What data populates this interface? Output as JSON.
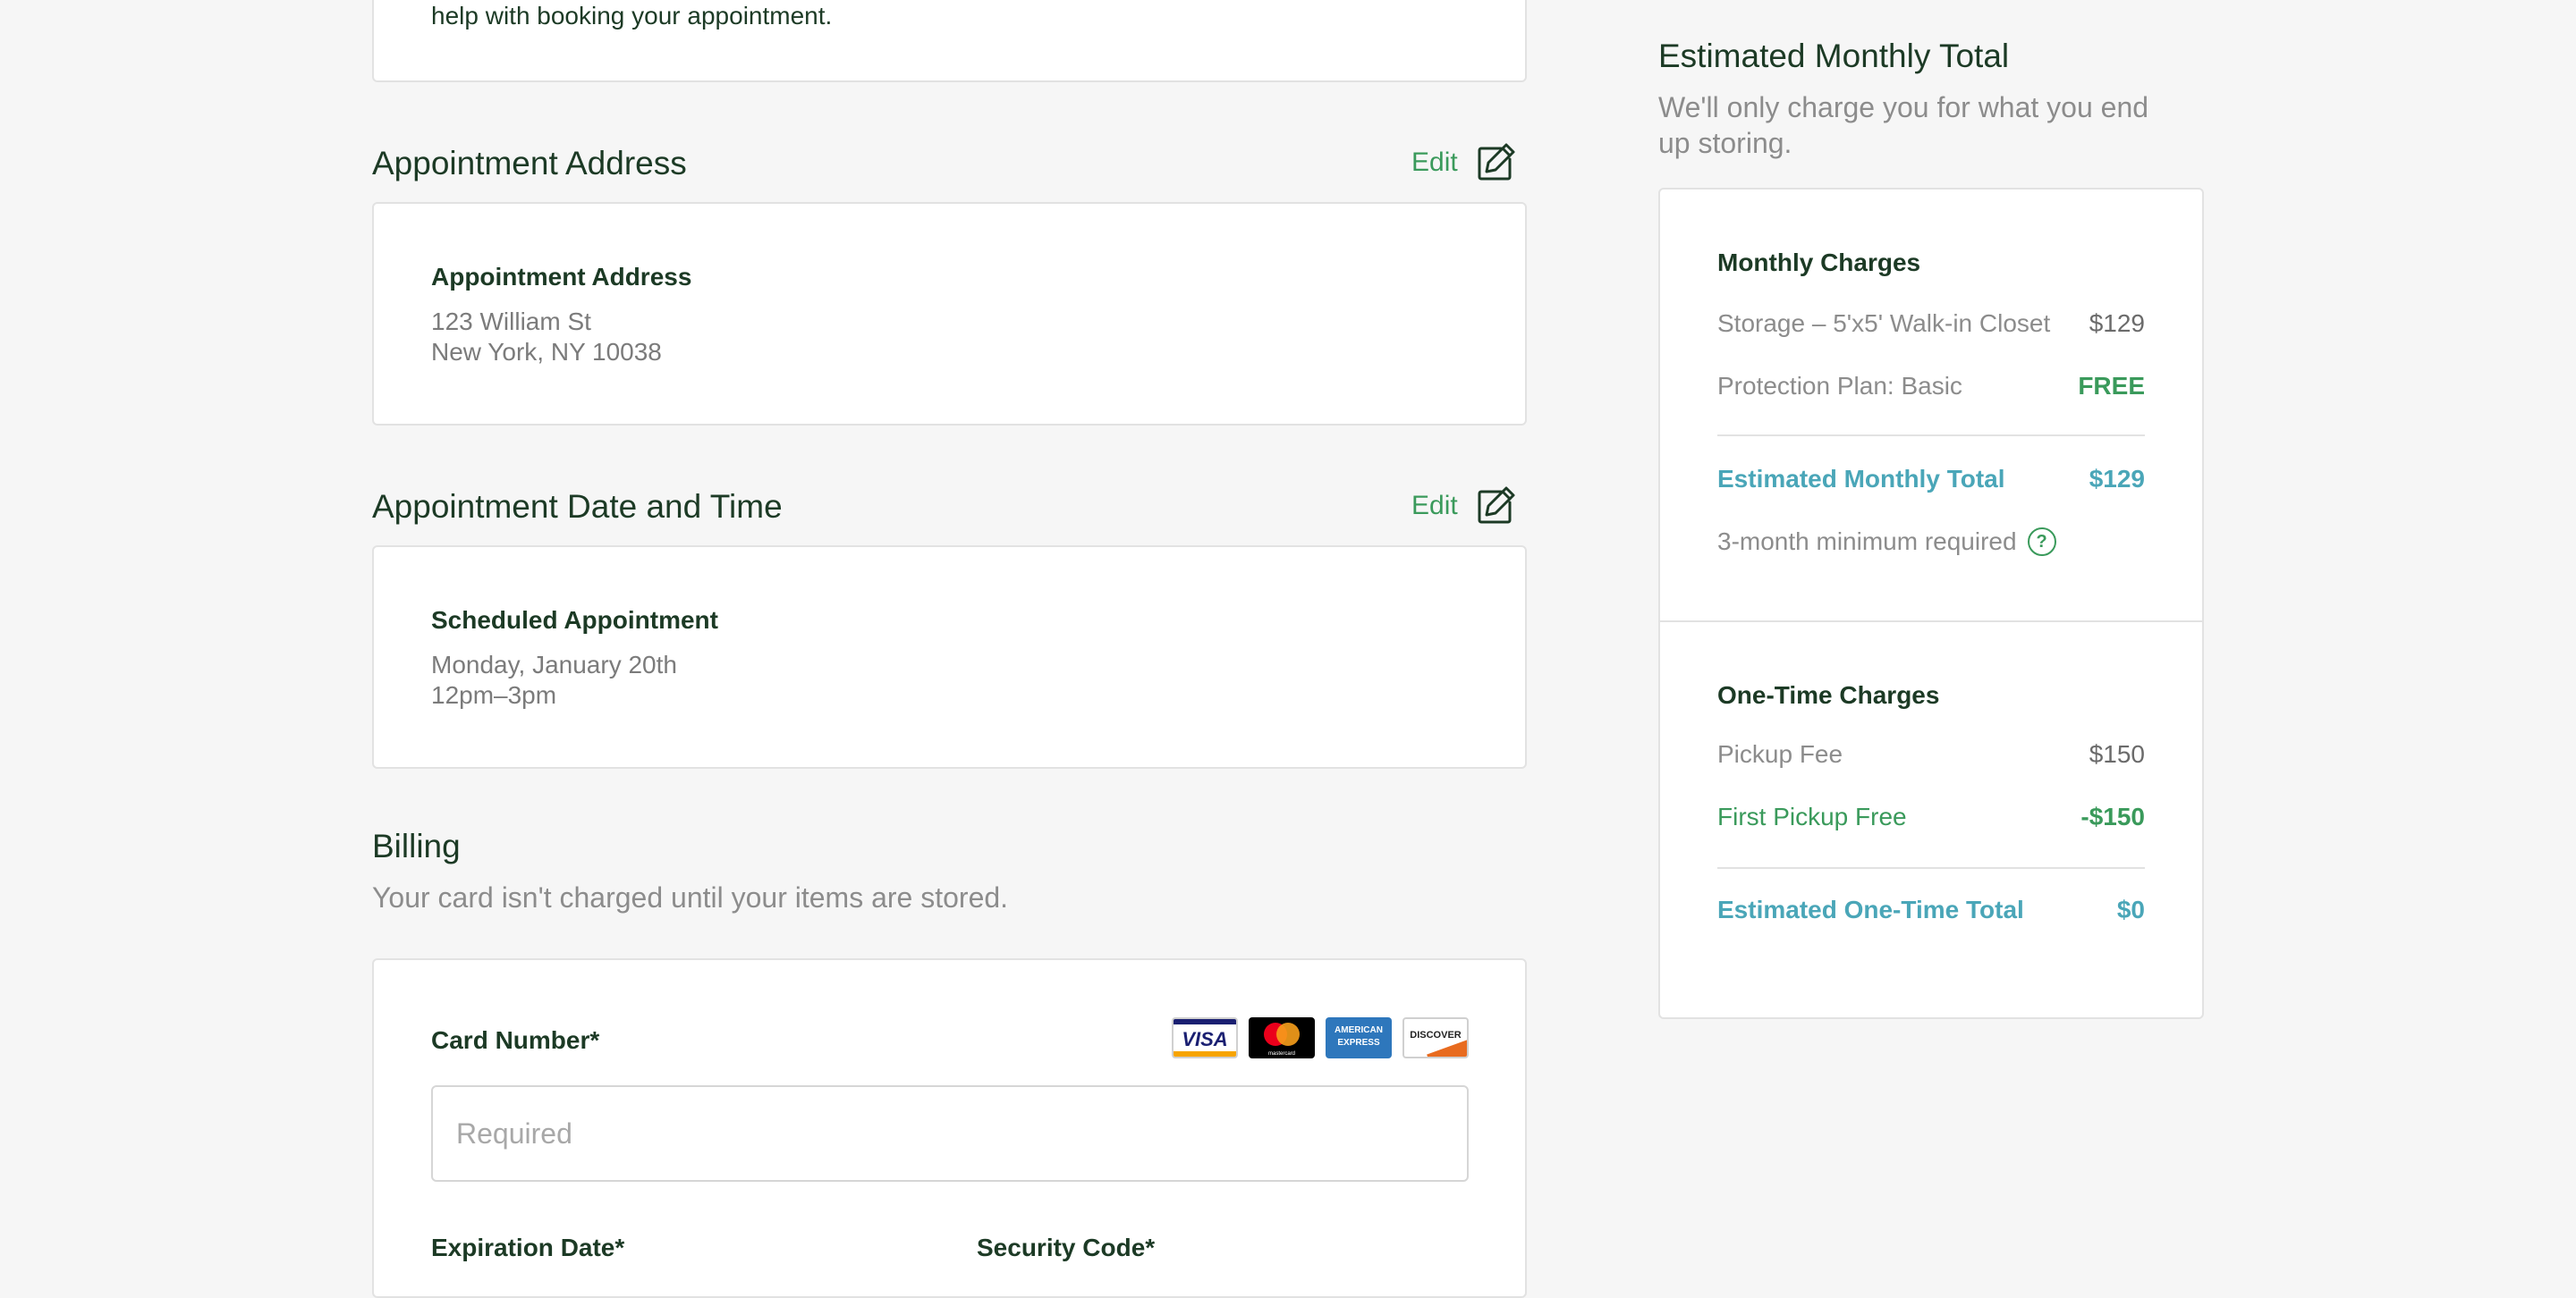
{
  "intro": {
    "tail_text": "help with booking your appointment."
  },
  "address_section": {
    "title": "Appointment Address",
    "edit_label": "Edit",
    "card_label": "Appointment Address",
    "line1": "123 William St",
    "line2": "New York, NY 10038"
  },
  "datetime_section": {
    "title": "Appointment Date and Time",
    "edit_label": "Edit",
    "card_label": "Scheduled Appointment",
    "line1": "Monday, January 20th",
    "line2": "12pm–3pm"
  },
  "billing": {
    "title": "Billing",
    "subtitle": "Your card isn't charged until your items are stored.",
    "card_number_label": "Card Number*",
    "card_number_placeholder": "Required",
    "expiration_label": "Expiration Date*",
    "security_label": "Security Code*",
    "card_logos": {
      "visa": "VISA",
      "mastercard": "mastercard",
      "amex": "AMERICAN EXPRESS",
      "discover": "DISCOVER"
    }
  },
  "summary": {
    "title": "Estimated Monthly Total",
    "subtitle_line1": "We'll only charge you for what you end",
    "subtitle_line2": "up storing.",
    "monthly": {
      "heading": "Monthly Charges",
      "items": [
        {
          "label": "Storage – 5'x5' Walk-in Closet",
          "value": "$129"
        },
        {
          "label": "Protection Plan: Basic",
          "value": "FREE"
        }
      ],
      "total_label": "Estimated Monthly Total",
      "total_value": "$129",
      "minimum_note": "3-month minimum required"
    },
    "one_time": {
      "heading": "One-Time Charges",
      "items": [
        {
          "label": "Pickup Fee",
          "value": "$150"
        },
        {
          "label": "First Pickup Free",
          "value": "-$150"
        }
      ],
      "total_label": "Estimated One-Time Total",
      "total_value": "$0"
    }
  },
  "colors": {
    "accent_green": "#3a9a5b",
    "total_teal": "#4aa6b8",
    "heading_dark_green": "#1c3a25",
    "background": "#f6f6f6"
  }
}
